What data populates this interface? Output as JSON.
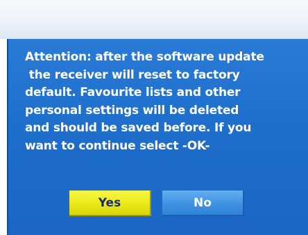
{
  "dialog": {
    "message": "Attention: after the software update\n the receiver will reset to factory\ndefault. Favourite lists and other\npersonal settings will be deleted\nand should be saved before. If you\nwant to continue select -OK-",
    "buttons": {
      "yes_label": "Yes",
      "no_label": "No"
    },
    "selected_button": "Yes"
  },
  "colors": {
    "dialog_background": "#1f6fcd",
    "message_text": "#ffffff",
    "yes_button_background": "#eaea18",
    "yes_button_text": "#1b2a6a",
    "no_button_background": "#3f92e3",
    "no_button_text": "#ffffff"
  }
}
